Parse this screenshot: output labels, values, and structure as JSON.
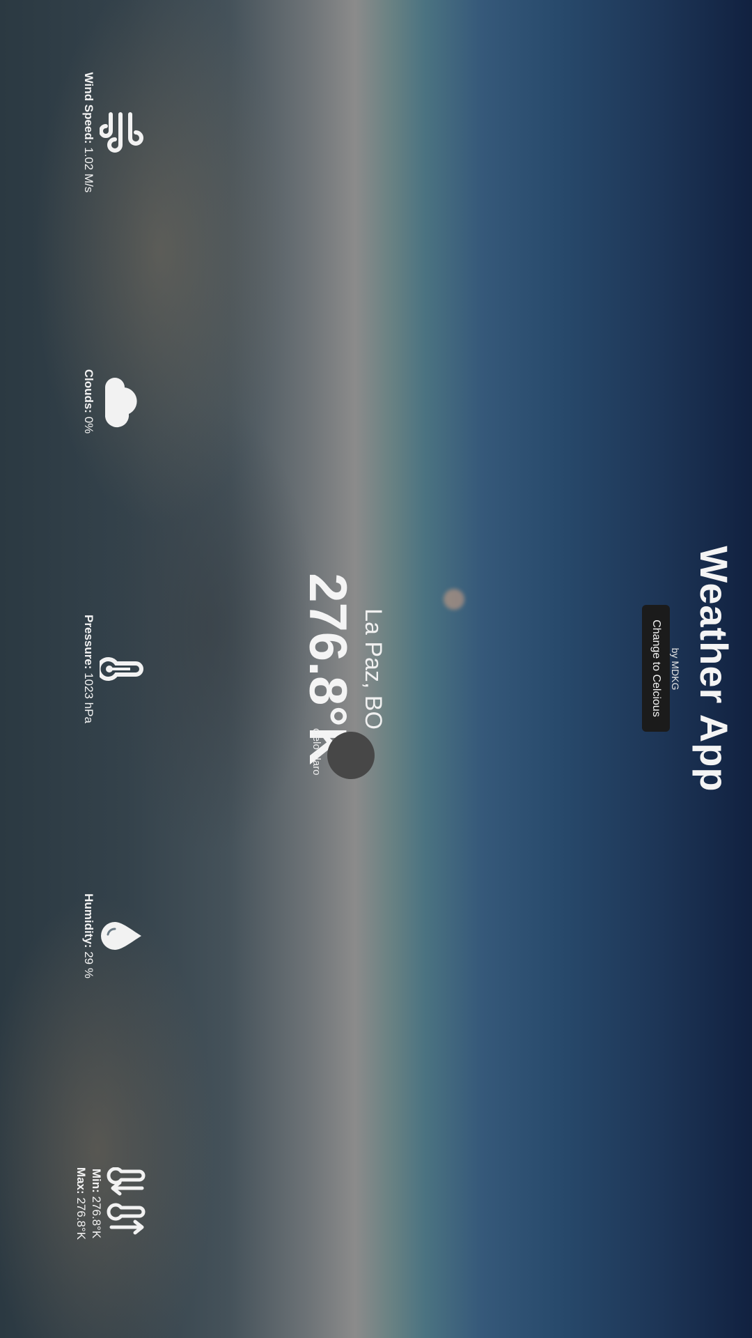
{
  "header": {
    "title": "Weather App",
    "byline": "by MDKG",
    "unit_button": "Change to Celcious"
  },
  "current": {
    "location": "La Paz, BO",
    "temperature": "276.8°K",
    "description": "cielo claro",
    "icon": "clear-sky-icon"
  },
  "stats": {
    "wind": {
      "icon": "wind-icon",
      "label": "Wind Speed:",
      "value": "1.02 M/s"
    },
    "clouds": {
      "icon": "cloud-icon",
      "label": "Clouds:",
      "value": "0%"
    },
    "pressure": {
      "icon": "thermometer-icon",
      "label": "Pressure:",
      "value": "1023 hPa"
    },
    "humidity": {
      "icon": "droplet-icon",
      "label": "Humidity:",
      "value": "29 %"
    },
    "minmax": {
      "icon": "min-max-temperature-icon",
      "min_label": "Min:",
      "min_value": "276.8°K",
      "max_label": "Max:",
      "max_value": "276.8°K"
    }
  },
  "colors": {
    "sky_dark": "#112140",
    "sky_horizon": "#8b8b8b",
    "clouds": "#2b3942",
    "button_bg": "#1b1b1b"
  }
}
